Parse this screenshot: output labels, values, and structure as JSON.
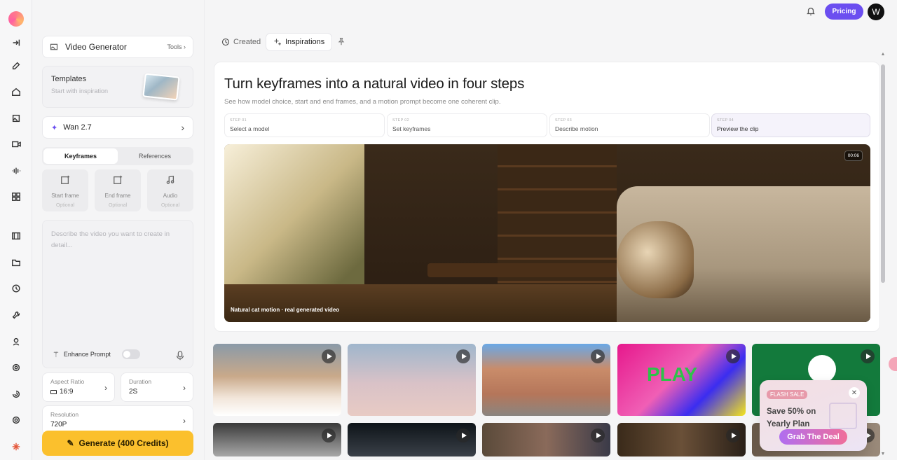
{
  "rail": {
    "icons": [
      "logo",
      "collapse-icon",
      "edit-icon",
      "home-icon",
      "gallery-icon",
      "video-icon",
      "audio-wave-icon",
      "grid-icon",
      "film-icon",
      "folder-icon",
      "history-icon",
      "wrench-icon",
      "avatar-icon",
      "openai-icon",
      "spiral-icon",
      "settings-icon",
      "sparkle-icon"
    ]
  },
  "panel": {
    "generator": {
      "title": "Video Generator",
      "tools": "Tools ›"
    },
    "templates": {
      "title": "Templates",
      "subtitle": "Start with inspiration"
    },
    "model": {
      "name": "Wan 2.7"
    },
    "tabs": [
      "Keyframes",
      "References"
    ],
    "keyframes": [
      {
        "label": "Start frame",
        "sub": "Optional"
      },
      {
        "label": "End frame",
        "sub": "Optional"
      },
      {
        "label": "Audio",
        "sub": "Optional"
      }
    ],
    "prompt": {
      "placeholder": "Describe the video you want to create in detail...",
      "enhance": "Enhance Prompt"
    },
    "aspect": {
      "label": "Aspect Ratio",
      "value": "16:9"
    },
    "duration": {
      "label": "Duration",
      "value": "2S"
    },
    "resolution": {
      "label": "Resolution",
      "value": "720P"
    },
    "generate": "Generate (400 Credits)"
  },
  "topbar": {
    "pricing": "Pricing",
    "avatar": "W"
  },
  "main_tabs": {
    "created": "Created",
    "inspirations": "Inspirations"
  },
  "hero": {
    "title": "Turn keyframes into a natural video in four steps",
    "subtitle": "See how model choice, start and end frames, and a motion prompt become one coherent clip.",
    "steps": [
      {
        "num": "STEP 01",
        "label": "Select a model"
      },
      {
        "num": "STEP 02",
        "label": "Set keyframes"
      },
      {
        "num": "STEP 03",
        "label": "Describe motion"
      },
      {
        "num": "STEP 04",
        "label": "Preview the clip"
      }
    ],
    "video_caption": "Natural cat motion · real generated video",
    "video_time": "00:06"
  },
  "thumbs_row1_text": [
    "PLAY"
  ],
  "flash": {
    "badge": "FLASH SALE",
    "message": "Save 50% on Yearly Plan",
    "cta": "Grab The Deal"
  }
}
